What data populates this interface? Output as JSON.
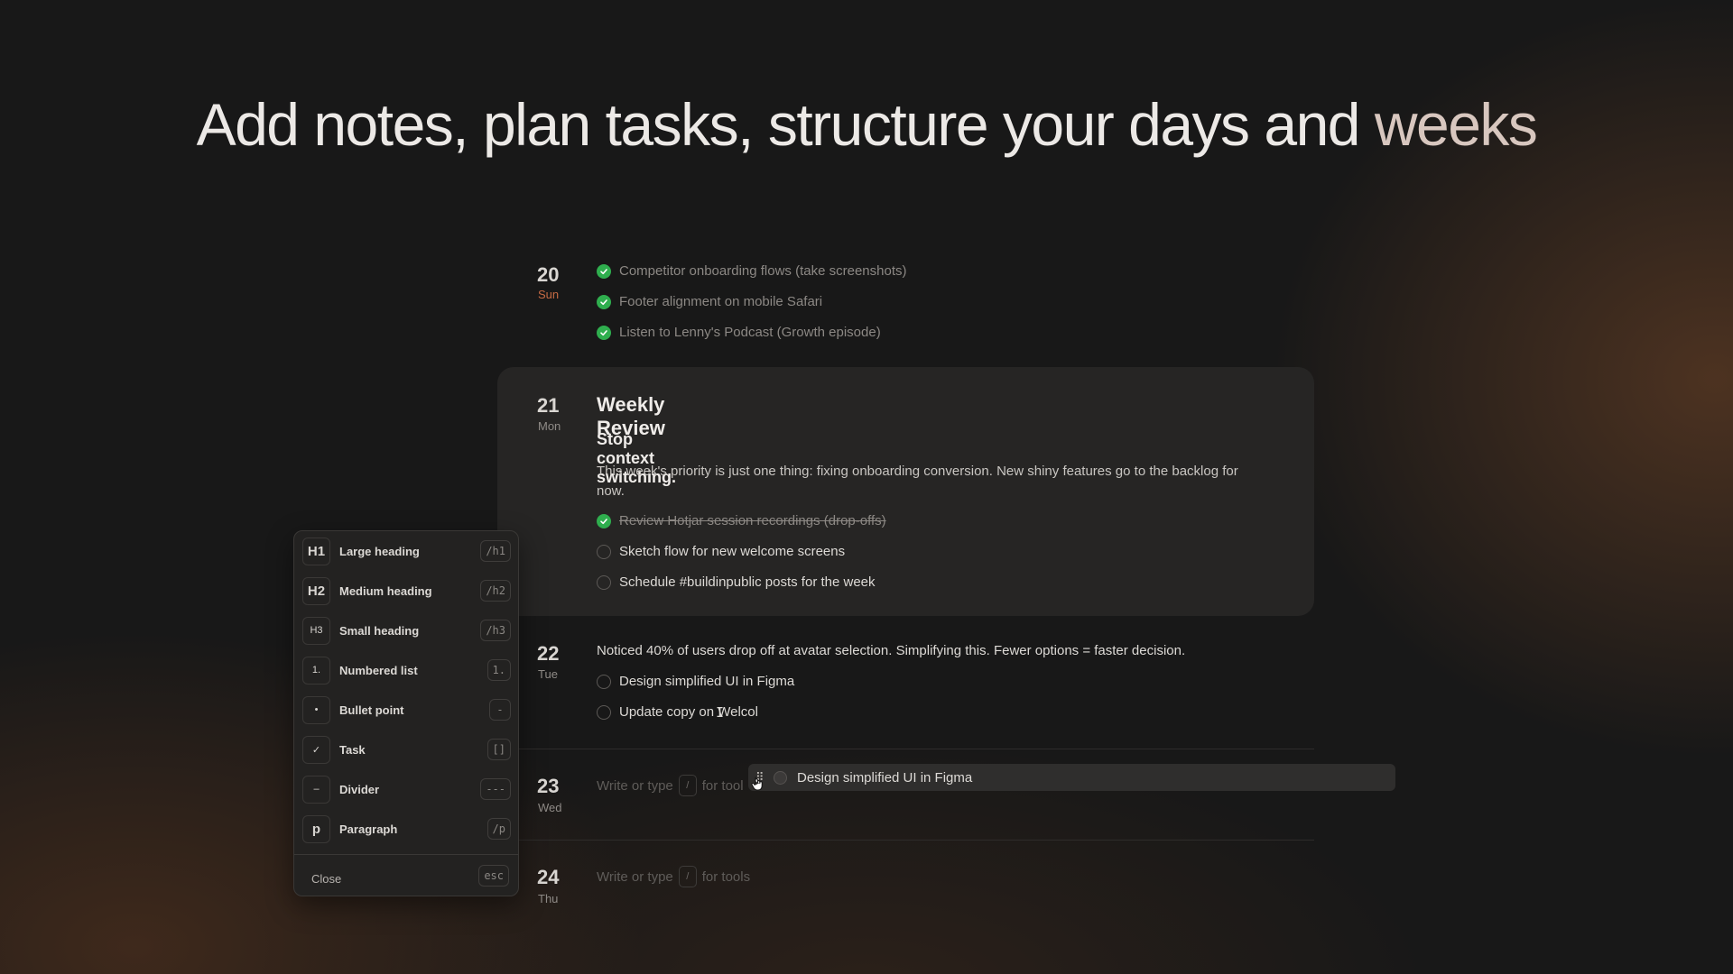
{
  "headline": {
    "main": "Add notes, plan tasks, structure your days and",
    "tail": "weeks"
  },
  "days": {
    "sun": {
      "num": "20",
      "weekday": "Sun",
      "tasks": [
        "Competitor onboarding flows (take screenshots)",
        "Footer alignment on mobile Safari",
        "Listen to Lenny's Podcast (Growth episode)"
      ]
    },
    "mon": {
      "num": "21",
      "weekday": "Mon",
      "title": "Weekly Review",
      "subtitle": "Stop context switching.",
      "paragraph": "This week's priority is just one thing: fixing onboarding conversion. New shiny features go to the backlog for now.",
      "tasks": [
        "Review Hotjar session recordings (drop-offs)",
        "Sketch flow for new welcome screens",
        "Schedule #buildinpublic posts for the week"
      ]
    },
    "tue": {
      "num": "22",
      "weekday": "Tue",
      "note": "Noticed 40% of users drop off at avatar selection. Simplifying this. Fewer options = faster decision.",
      "tasks": [
        "Design simplified UI in Figma",
        "Update copy on Welcol"
      ]
    },
    "wed": {
      "num": "23",
      "weekday": "Wed"
    },
    "thu": {
      "num": "24",
      "weekday": "Thu"
    }
  },
  "placeholder": {
    "before": "Write or type",
    "key": "/",
    "after": "for tools",
    "after_truncated": "for tool"
  },
  "drag_ghost": {
    "label": "Design simplified UI in Figma"
  },
  "menu": {
    "items": [
      {
        "icon": "H1",
        "label": "Large heading",
        "shortcut": "/h1"
      },
      {
        "icon": "H2",
        "label": "Medium heading",
        "shortcut": "/h2"
      },
      {
        "icon": "H3",
        "label": "Small heading",
        "shortcut": "/h3"
      },
      {
        "icon": "1.",
        "label": "Numbered list",
        "shortcut": "1."
      },
      {
        "icon": "•",
        "label": "Bullet point",
        "shortcut": "-"
      },
      {
        "icon": "✓",
        "label": "Task",
        "shortcut": "[]"
      },
      {
        "icon": "–",
        "label": "Divider",
        "shortcut": "---"
      },
      {
        "icon": "p",
        "label": "Paragraph",
        "shortcut": "/p"
      }
    ],
    "close_label": "Close",
    "close_key": "esc"
  },
  "colors": {
    "done": "#2fae4e",
    "sunday": "#c56a44",
    "background": "#181818",
    "card": "#262524"
  }
}
